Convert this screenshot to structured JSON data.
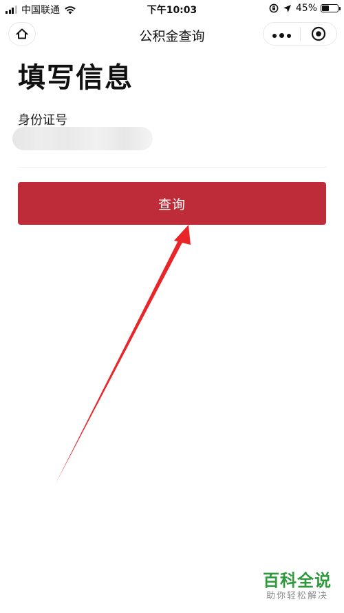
{
  "status_bar": {
    "carrier": "中国联通",
    "time": "下午10:03",
    "battery": "45%",
    "battery_level": 0.45
  },
  "nav": {
    "title": "公积金查询"
  },
  "form": {
    "title": "填写信息",
    "id_label": "身份证号",
    "id_value": "",
    "submit_label": "查询"
  },
  "colors": {
    "primary": "#bf2c39",
    "arrow": "#e8262a",
    "watermark": "#2f9a3c"
  },
  "watermark": {
    "title": "百科全说",
    "subtitle": "助你轻松解决"
  }
}
